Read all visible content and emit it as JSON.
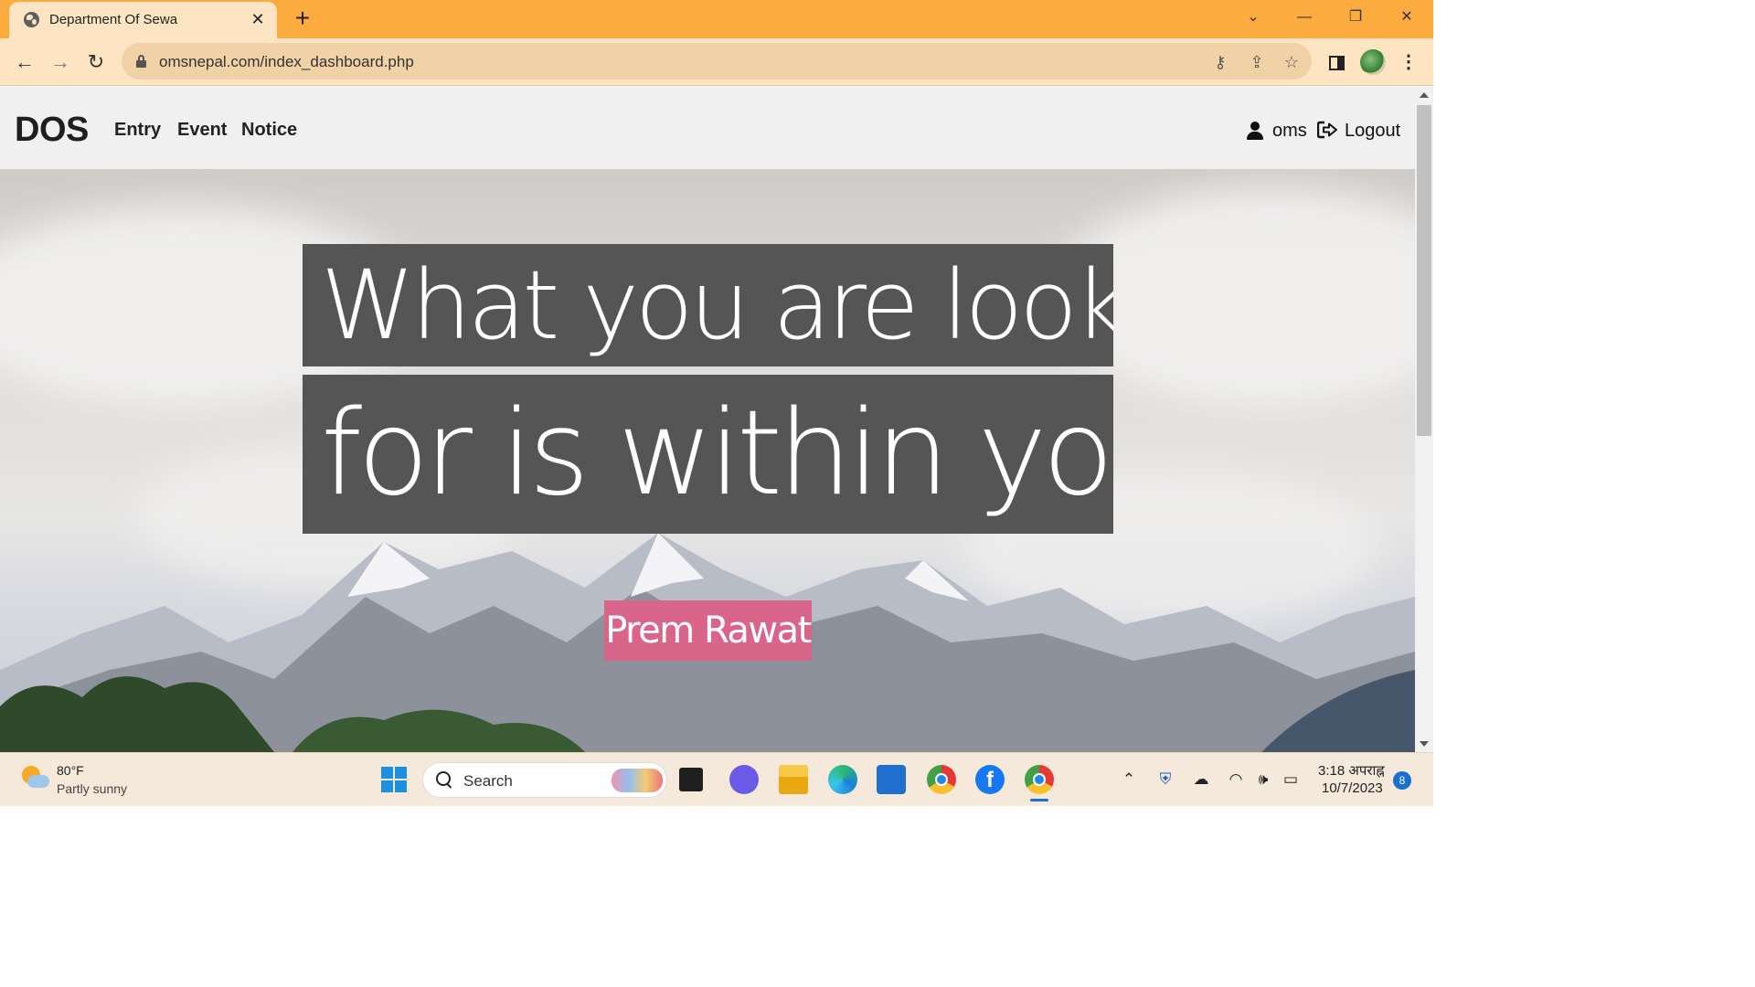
{
  "browser": {
    "tab_title": "Department Of Sewa",
    "tab_close": "✕",
    "new_tab": "+",
    "url": "omsnepal.com/index_dashboard.php",
    "window_controls": {
      "tab_search": "⌄",
      "minimize": "—",
      "restore": "❐",
      "close": "✕"
    },
    "nav": {
      "back": "←",
      "forward": "→",
      "reload": "↻"
    },
    "omnibox_icons": {
      "key": "⚷",
      "share": "⇪",
      "star": "☆"
    },
    "menu": "⋮"
  },
  "site": {
    "brand": "DOS",
    "nav_links": [
      "Entry",
      "Event",
      "Notice"
    ],
    "username": "oms",
    "logout_label": "Logout"
  },
  "hero": {
    "quote_lines": [
      "What you are looking",
      "for is within you."
    ],
    "author": "Prem Rawat",
    "colors": {
      "quote_bg": "#555555",
      "author_bg": "#d9658a"
    }
  },
  "taskbar": {
    "weather_temp": "80°F",
    "weather_desc": "Partly sunny",
    "search_label": "Search",
    "facebook_glyph": "f",
    "tray": {
      "chevron": "⌃",
      "defender": "⛨",
      "onedrive": "☁",
      "wifi": "◠",
      "volume": "🕪",
      "battery": "▭"
    },
    "time": "3:18 अपराह्न",
    "date": "10/7/2023",
    "notifications": "8"
  },
  "colors": {
    "tabstrip": "#fcab3e",
    "toolbar": "#fde4c2",
    "site_nav": "#f0f0f0"
  }
}
